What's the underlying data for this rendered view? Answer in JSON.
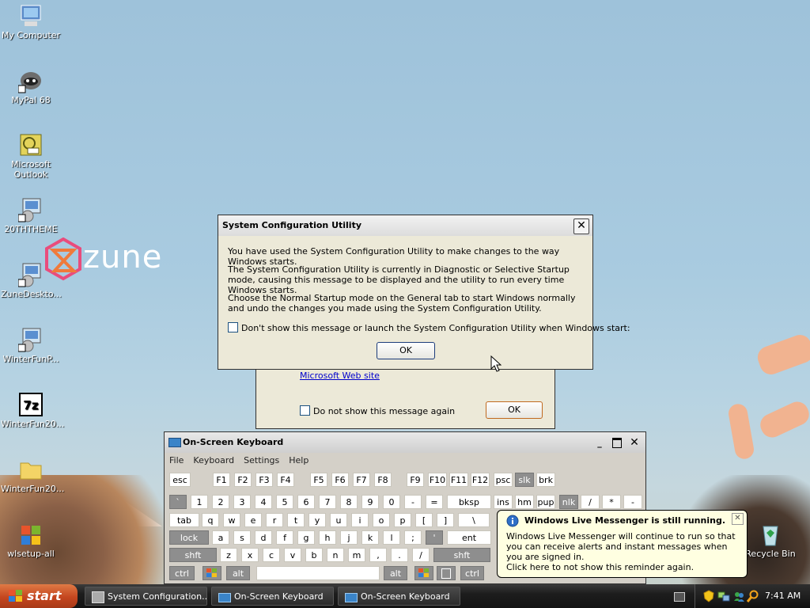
{
  "desktop": {
    "icons": [
      {
        "label": "My Computer",
        "icon": "my-computer-icon"
      },
      {
        "label": "MyPal 68",
        "icon": "raccoon-shortcut-icon"
      },
      {
        "label": "Microsoft Outlook",
        "icon": "outlook-icon"
      },
      {
        "label": "20THTHEME",
        "icon": "installer-package-icon"
      },
      {
        "label": "ZuneDeskto...",
        "icon": "installer-package-icon"
      },
      {
        "label": "WinterFunP...",
        "icon": "installer-package-icon"
      },
      {
        "label": "WinterFun20...",
        "icon": "7zip-archive-icon"
      },
      {
        "label": "WinterFun20...",
        "icon": "folder-icon"
      },
      {
        "label": "wlsetup-all",
        "icon": "windows-flag-icon"
      },
      {
        "label": "Recycle Bin",
        "icon": "recycle-bin-icon"
      }
    ],
    "wallpaper_logo": "zune"
  },
  "msconfig_dialog": {
    "title": "System Configuration Utility",
    "para1": "You have used the System Configuration Utility to make changes to the way Windows starts.",
    "para2": "The System Configuration Utility is currently in Diagnostic or Selective Startup mode, causing this message to be displayed and the utility to run every time Windows starts.",
    "para3": "Choose the Normal Startup mode on the General tab to start Windows normally and undo the changes you made using the System Configuration Utility.",
    "checkbox_label": "Don't show this message or launch the System Configuration Utility when Windows start:",
    "ok_label": "OK"
  },
  "behind_dialog": {
    "link": "Microsoft Web site",
    "checkbox_label": "Do not show this message again",
    "ok_label": "OK"
  },
  "osk": {
    "title": "On-Screen Keyboard",
    "menu": [
      "File",
      "Keyboard",
      "Settings",
      "Help"
    ],
    "rows": [
      [
        "esc",
        "F1",
        "F2",
        "F3",
        "F4",
        "F5",
        "F6",
        "F7",
        "F8",
        "F9",
        "F10",
        "F11",
        "F12",
        "psc",
        "slk",
        "brk"
      ],
      [
        "`",
        "1",
        "2",
        "3",
        "4",
        "5",
        "6",
        "7",
        "8",
        "9",
        "0",
        "-",
        "=",
        "bksp",
        "ins",
        "hm",
        "pup",
        "nlk",
        "/",
        "*",
        "-"
      ],
      [
        "tab",
        "q",
        "w",
        "e",
        "r",
        "t",
        "y",
        "u",
        "i",
        "o",
        "p",
        "[",
        "]",
        "\\"
      ],
      [
        "lock",
        "a",
        "s",
        "d",
        "f",
        "g",
        "h",
        "j",
        "k",
        "l",
        ";",
        "'",
        "ent"
      ],
      [
        "shft",
        "z",
        "x",
        "c",
        "v",
        "b",
        "n",
        "m",
        ",",
        ".",
        "/",
        "shft"
      ],
      [
        "ctrl",
        "alt",
        "alt",
        "ctrl"
      ]
    ]
  },
  "balloon": {
    "title": "Windows Live Messenger is still running.",
    "body": "Windows Live Messenger will continue to run so that you can receive alerts and instant messages when you are signed in.",
    "footer": "Click here to not show this reminder again."
  },
  "taskbar": {
    "start_label": "start",
    "tasks": [
      "System Configuration...",
      "On-Screen Keyboard",
      "On-Screen Keyboard"
    ],
    "clock": "7:41 AM"
  }
}
